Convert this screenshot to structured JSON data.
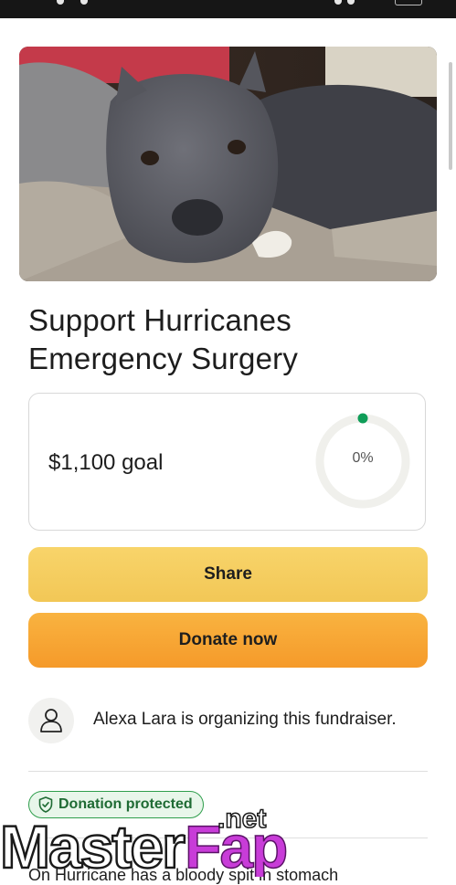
{
  "fundraiser": {
    "title_line1": "Support Hurricanes",
    "title_line2": "Emergency Surgery",
    "goal_text": "$1,100 goal",
    "progress_label": "0%",
    "progress_fraction": 0
  },
  "actions": {
    "share_label": "Share",
    "donate_label": "Donate now"
  },
  "organizer": {
    "text": "Alexa Lara is organizing this fundraiser."
  },
  "badge": {
    "label": "Donation protected"
  },
  "story": {
    "first_line": "On Hurricane has a bloody spit in stomach"
  },
  "watermark": {
    "brand_part1": "Master",
    "brand_part2": "Fap",
    "domain": ".net"
  },
  "colors": {
    "share_button": "#f5cd5f",
    "donate_button": "#f7a635",
    "progress_dot": "#0f9d58",
    "badge_green": "#2f9e4c"
  },
  "icons": {
    "avatar": "person-icon",
    "badge": "shield-check-icon"
  }
}
